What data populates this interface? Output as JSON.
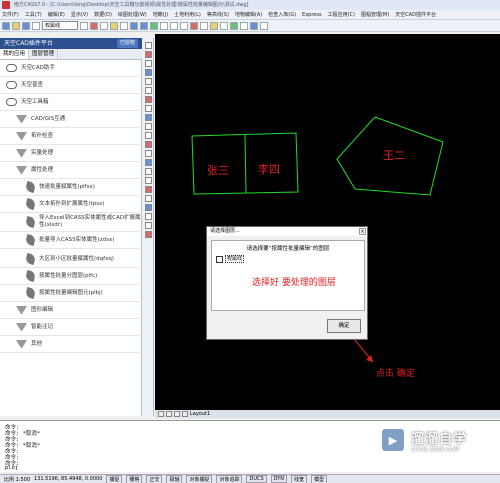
{
  "title_bar": {
    "text": "南方CASS7.0 - [C:\\Users\\long\\Desktop\\天空工具箱功能视频\\属性处理\\按属性批量编辑图元\\测试.dwg]"
  },
  "menubar": {
    "items": [
      "文件(F)",
      "工具(T)",
      "编辑(E)",
      "显示(V)",
      "数据(D)",
      "绘图处理(W)",
      "地籍(J)",
      "土地利用(L)",
      "等高线(S)",
      "地物编辑(A)",
      "检查入库(G)",
      "Express",
      "工程应用(C)",
      "图幅管理(M)",
      "天空CAD插件平台"
    ]
  },
  "toolbar": {
    "layer_value": "权属线"
  },
  "panel": {
    "title": "天空CAD插件平台",
    "title_button": "已授权",
    "tabs": [
      "我的应用",
      "图层管理"
    ],
    "items": [
      {
        "label": "天空CAD助手",
        "icon": "cloud-icon"
      },
      {
        "label": "天空普查",
        "icon": "cloud-icon"
      },
      {
        "label": "天空工具箱",
        "icon": "cloud-icon"
      },
      {
        "label": "CAD/GIS互通",
        "icon": "folder-triangle-icon"
      },
      {
        "label": "拓扑检查",
        "icon": "folder-triangle-icon"
      },
      {
        "label": "实量处理",
        "icon": "folder-triangle-icon"
      },
      {
        "label": "属性处理",
        "icon": "folder-triangle-icon"
      },
      {
        "label": "快速批量赋属性(plfsx)",
        "icon": "leaf-icon"
      },
      {
        "label": "文本拓扑到扩展属性(tpsx)",
        "icon": "leaf-icon"
      },
      {
        "label": "导入Excel到CASS实体属性或CAD扩展属性(xlsdr)",
        "icon": "leaf-icon"
      },
      {
        "label": "批量导入CASS实体属性(zdsx)",
        "icon": "leaf-icon"
      },
      {
        "label": "大区到小区批量赋属性(dqfxq)",
        "icon": "leaf-icon"
      },
      {
        "label": "按属性批量分图层(plfc)",
        "icon": "leaf-icon"
      },
      {
        "label": "按属性批量编辑图元(plbj)",
        "icon": "leaf-icon"
      },
      {
        "label": "图形编辑",
        "icon": "folder-triangle-icon"
      },
      {
        "label": "智能注记",
        "icon": "folder-triangle-icon"
      },
      {
        "label": "其他",
        "icon": "folder-triangle-icon"
      }
    ]
  },
  "drawing": {
    "labels": [
      "张三",
      "李四",
      "王二"
    ],
    "colors": {
      "parcel_line": "#22dd22",
      "label_text": "#e02020"
    }
  },
  "layout_tabs": {
    "label": "Layout1"
  },
  "dialog": {
    "title": "请选择图层...",
    "close_label": "×",
    "heading": "请选择要“按属性批量编辑”的图层",
    "layer_option": "权属线",
    "annotation": "选择好  要处理的图层",
    "ok_label": "确定"
  },
  "annotation_confirm": "点击  确定",
  "command_lines": [
    "命令:",
    "命令: *取消*",
    "命令:",
    "命令: *取消*",
    "命令:",
    "命令:",
    "命令:",
    "plbj"
  ],
  "status_bar": {
    "coords_label": "比例 1:500",
    "coords": "131.5196, 85.4948, 0.0000",
    "modes": [
      "捕捉",
      "栅格",
      "正交",
      "极轴",
      "对象捕捉",
      "对象追踪",
      "DUCS",
      "DYN",
      "线宽",
      "模型"
    ]
  },
  "watermark": {
    "title": "溜溜自学",
    "url": "ZIXUE.3D66.COM",
    "logo_glyph": "▶"
  }
}
